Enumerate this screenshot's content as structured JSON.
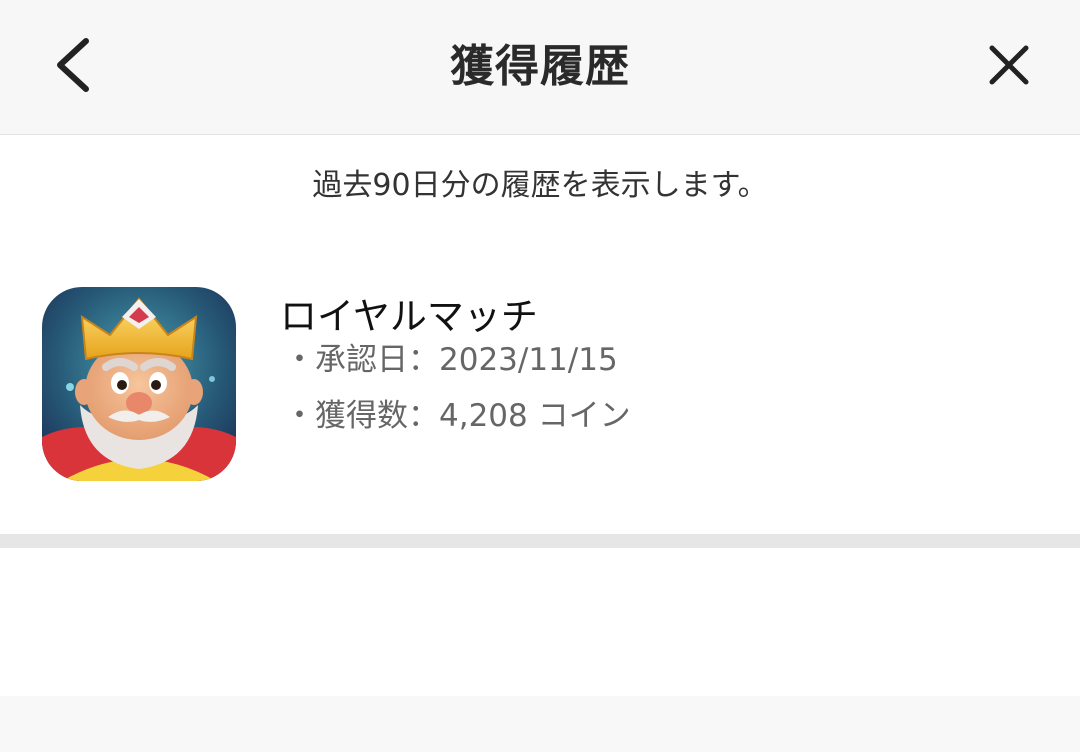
{
  "header": {
    "title": "獲得履歴",
    "back_icon": "chevron-left-icon",
    "close_icon": "close-icon"
  },
  "notice": "過去90日分の履歴を表示します。",
  "history": [
    {
      "app_name": "ロイヤルマッチ",
      "approved_date": "・承認日：2023/11/15",
      "earned": "・獲得数：4,208 コイン",
      "icon": "king-app-icon"
    }
  ],
  "colors": {
    "header_bg": "#f7f7f7",
    "divider": "#e6e6e6",
    "text_primary": "#111111",
    "text_secondary": "#666666"
  }
}
